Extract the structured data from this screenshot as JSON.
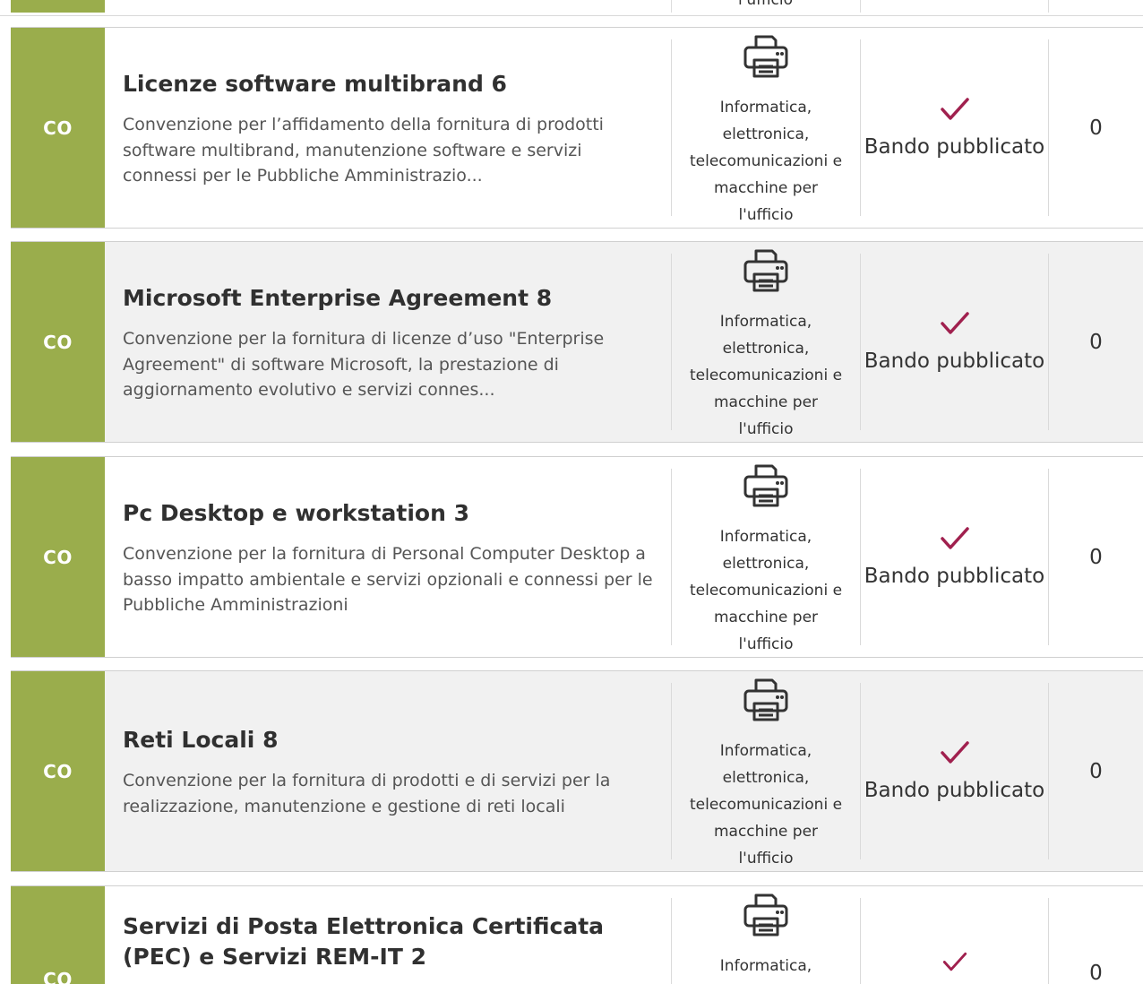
{
  "top_fragment": {
    "category_tail": "l'ufficio"
  },
  "rows": [
    {
      "badge": "CO",
      "title": "Licenze software multibrand 6",
      "description": "Convenzione per l’affidamento della fornitura di prodotti software multibrand, manutenzione software e servizi connessi per le Pubbliche Amministrazio...",
      "category_icon": "printer-icon",
      "category": [
        "Informatica,",
        "elettronica,",
        "telecomunicazioni e",
        "macchine per",
        "l'ufficio"
      ],
      "status_icon": "check-icon",
      "status": "Bando pubblicato",
      "count": "0"
    },
    {
      "badge": "CO",
      "title": "Microsoft Enterprise Agreement 8",
      "description": "Convenzione per la fornitura di licenze d’uso \"Enterprise Agreement\" di software Microsoft, la prestazione di aggiornamento evolutivo e servizi connes...",
      "category_icon": "printer-icon",
      "category": [
        "Informatica,",
        "elettronica,",
        "telecomunicazioni e",
        "macchine per",
        "l'ufficio"
      ],
      "status_icon": "check-icon",
      "status": "Bando pubblicato",
      "count": "0"
    },
    {
      "badge": "CO",
      "title": "Pc Desktop e workstation 3",
      "description": "Convenzione per la fornitura di Personal Computer Desktop a basso impatto ambientale e servizi opzionali e connessi per le Pubbliche Amministrazioni",
      "category_icon": "printer-icon",
      "category": [
        "Informatica,",
        "elettronica,",
        "telecomunicazioni e",
        "macchine per",
        "l'ufficio"
      ],
      "status_icon": "check-icon",
      "status": "Bando pubblicato",
      "count": "0"
    },
    {
      "badge": "CO",
      "title": "Reti Locali 8",
      "description": "Convenzione per la fornitura di prodotti e di servizi per la realizzazione, manutenzione e gestione di reti locali",
      "category_icon": "printer-icon",
      "category": [
        "Informatica,",
        "elettronica,",
        "telecomunicazioni e",
        "macchine per",
        "l'ufficio"
      ],
      "status_icon": "check-icon",
      "status": "Bando pubblicato",
      "count": "0"
    },
    {
      "badge": "CO",
      "title": "Servizi di Posta Elettronica Certificata (PEC) e Servizi REM-IT 2",
      "description": "",
      "category_icon": "printer-icon",
      "category": [
        "Informatica,"
      ],
      "status_icon": "check-icon",
      "status": "",
      "count": "0"
    }
  ],
  "colors": {
    "badge_bg": "#9aad4c",
    "check": "#a0204e",
    "row_alt_bg": "#f1f1f1"
  }
}
